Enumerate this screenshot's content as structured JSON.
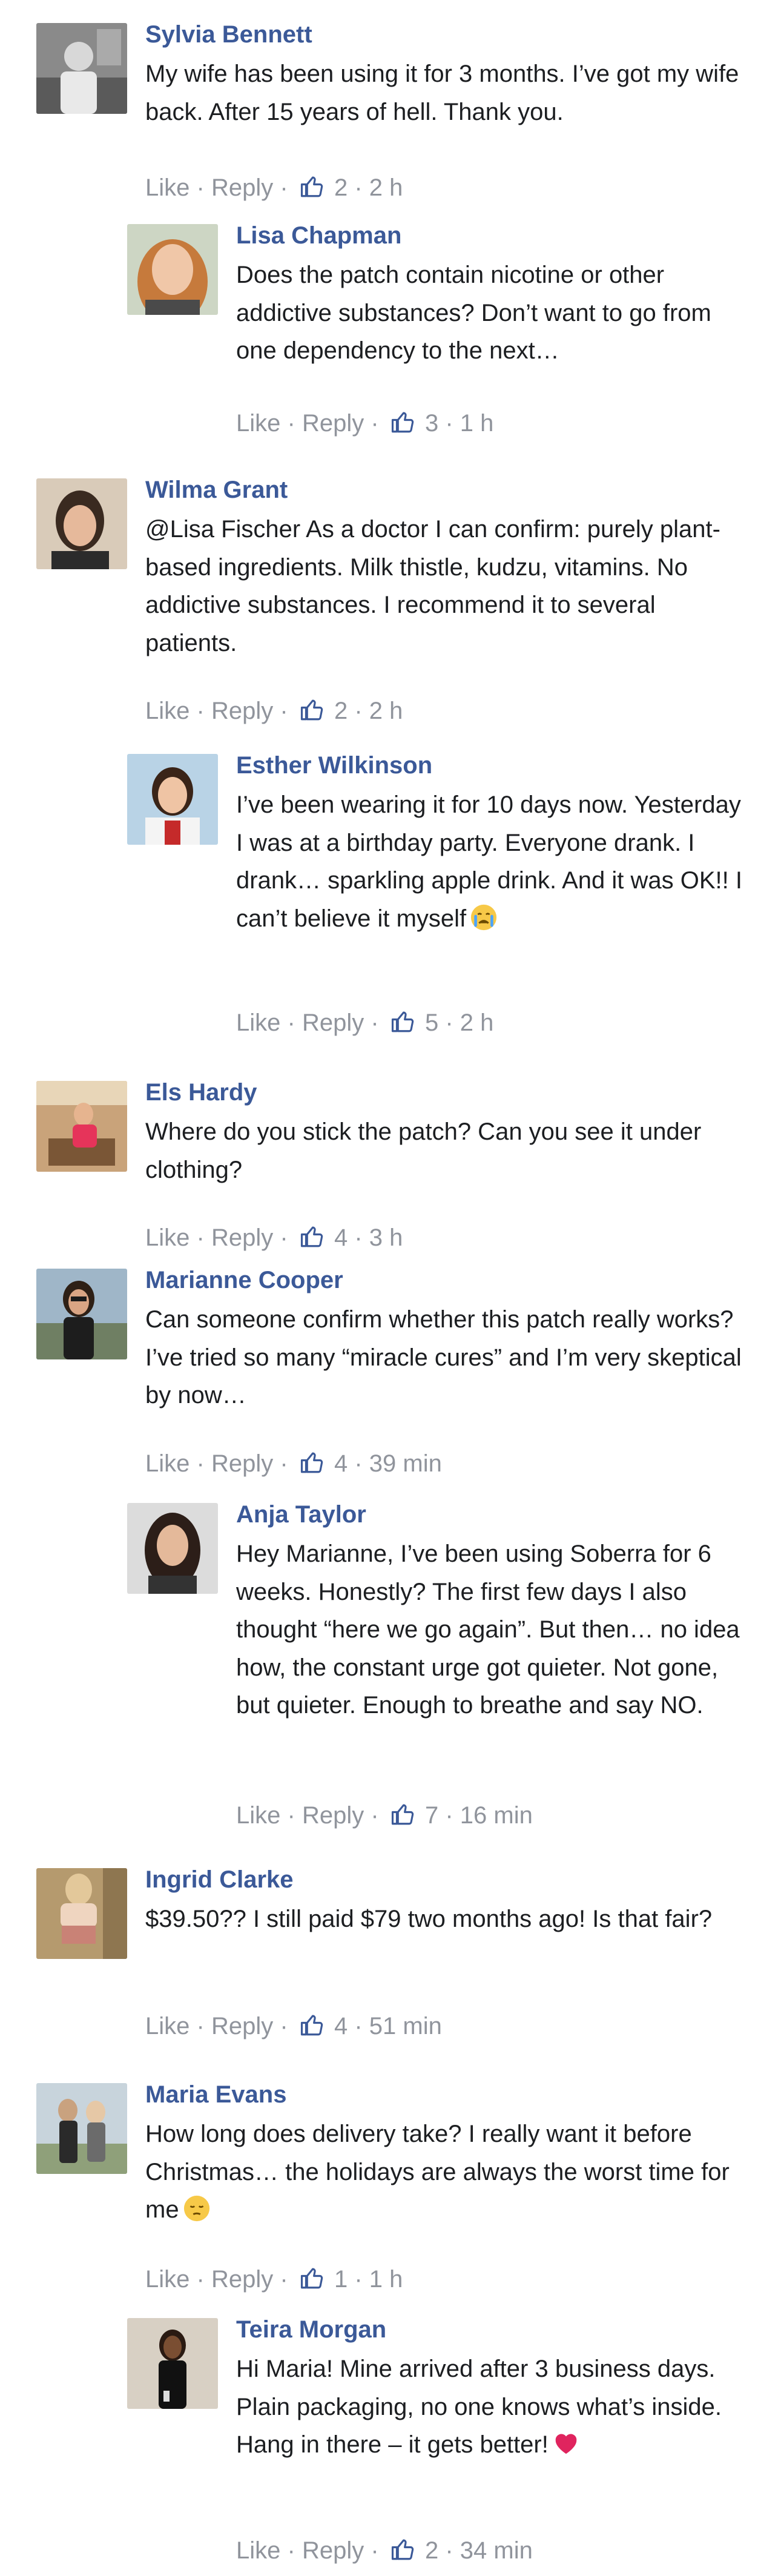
{
  "actions": {
    "like": "Like",
    "reply": "Reply",
    "sep": "·"
  },
  "comments": [
    {
      "name": "Sylvia Bennett",
      "text": "My wife has been using it for 3 months. I’ve got my wife back. After 15 years of hell. Thank you.",
      "likes": "2",
      "time": "2 h"
    },
    {
      "name": "Lisa Chapman",
      "text": "Does the patch contain nicotine or other addictive substances? Don’t want to go from one dependency to the next…",
      "likes": "3",
      "time": "1 h"
    },
    {
      "name": "Wilma Grant",
      "text": "@Lisa Fischer As a doctor I can confirm: purely plant-based ingredients. Milk thistle, kudzu, vitamins. No addictive substances. I recommend it to several patients.",
      "likes": "2",
      "time": "2 h"
    },
    {
      "name": "Esther Wilkinson",
      "text": "I’ve been wearing it for 10 days now. Yesterday I was at a birthday party. Everyone drank. I drank… sparkling apple drink. And it was OK!! I can’t believe it myself",
      "emoji": "😭",
      "likes": "5",
      "time": "2 h"
    },
    {
      "name": "Els Hardy",
      "text": "Where do you stick the patch? Can you see it under clothing?",
      "likes": "4",
      "time": "3 h"
    },
    {
      "name": "Marianne Cooper",
      "text": "Can someone confirm whether this patch really works? I’ve tried so many “miracle cures” and I’m very skeptical by now…",
      "likes": "4",
      "time": "39 min"
    },
    {
      "name": "Anja Taylor",
      "text": "Hey Marianne, I’ve been using Soberra for 6 weeks. Honestly? The first few days I also thought “here we go again”. But then… no idea how, the constant urge got quieter. Not gone, but quieter. Enough to breathe and say NO.",
      "likes": "7",
      "time": "16 min"
    },
    {
      "name": "Ingrid Clarke",
      "text": "$39.50?? I still paid $79 two months ago! Is that fair?",
      "likes": "4",
      "time": "51 min"
    },
    {
      "name": "Maria Evans",
      "text": "How long does delivery take? I really want it before Christmas… the holidays are always the worst time for me",
      "emoji": "😔",
      "likes": "1",
      "time": "1 h"
    },
    {
      "name": "Teira Morgan",
      "text": "Hi Maria! Mine arrived after 3 business days. Plain packaging, no one knows what’s inside. Hang in there – it gets better!",
      "emoji": "❤️",
      "likes": "2",
      "time": "34 min"
    }
  ],
  "colors": {
    "name": "#3b5998",
    "text": "#1c1e21",
    "meta": "#90949c",
    "like_icon": "#3b5998"
  }
}
